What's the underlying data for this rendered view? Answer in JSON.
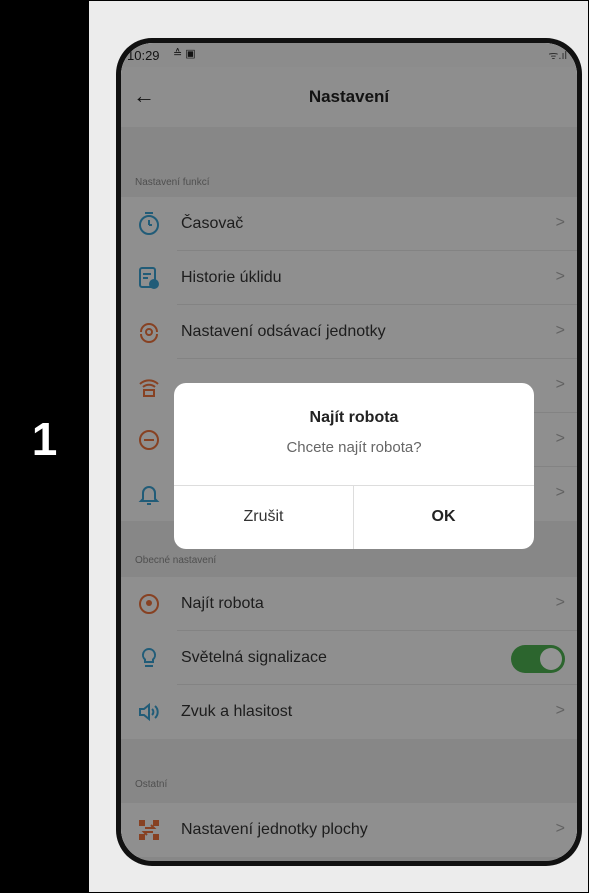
{
  "step_number": "1",
  "status_bar": {
    "time": "10:29",
    "icons": "≙ ▣",
    "signal": "ᯤ.ıl"
  },
  "appbar": {
    "back": "←",
    "title": "Nastavení"
  },
  "sections": {
    "functions_label": "Nastavení funkcí",
    "general_label": "Obecné nastavení",
    "other_label": "Ostatní"
  },
  "function_items": [
    {
      "label": "Časovač",
      "icon": "timer-icon",
      "color": "#3a9fcf"
    },
    {
      "label": "Historie úklidu",
      "icon": "history-icon",
      "color": "#3a9fcf"
    },
    {
      "label": "Nastavení odsávací jednotky",
      "icon": "suction-icon",
      "color": "#e8713c"
    },
    {
      "label": "",
      "icon": "wifi-icon",
      "color": "#e8713c"
    },
    {
      "label": "",
      "icon": "minus-circle-icon",
      "color": "#e8713c"
    },
    {
      "label": "",
      "icon": "bell-icon",
      "color": "#3a9fcf"
    }
  ],
  "general_items": [
    {
      "label": "Najít robota",
      "icon": "find-robot-icon",
      "color": "#e8713c"
    },
    {
      "label": "Světelná signalizace",
      "icon": "bulb-icon",
      "color": "#3a9fcf",
      "toggle": "on"
    },
    {
      "label": "Zvuk a hlasitost",
      "icon": "speaker-icon",
      "color": "#3a9fcf"
    }
  ],
  "other_items": [
    {
      "label": "Nastavení jednotky plochy",
      "icon": "area-unit-icon",
      "color": "#e8713c"
    }
  ],
  "chevron": ">",
  "dialog": {
    "title": "Najít robota",
    "message": "Chcete najít robota?",
    "cancel": "Zrušit",
    "ok": "OK"
  }
}
